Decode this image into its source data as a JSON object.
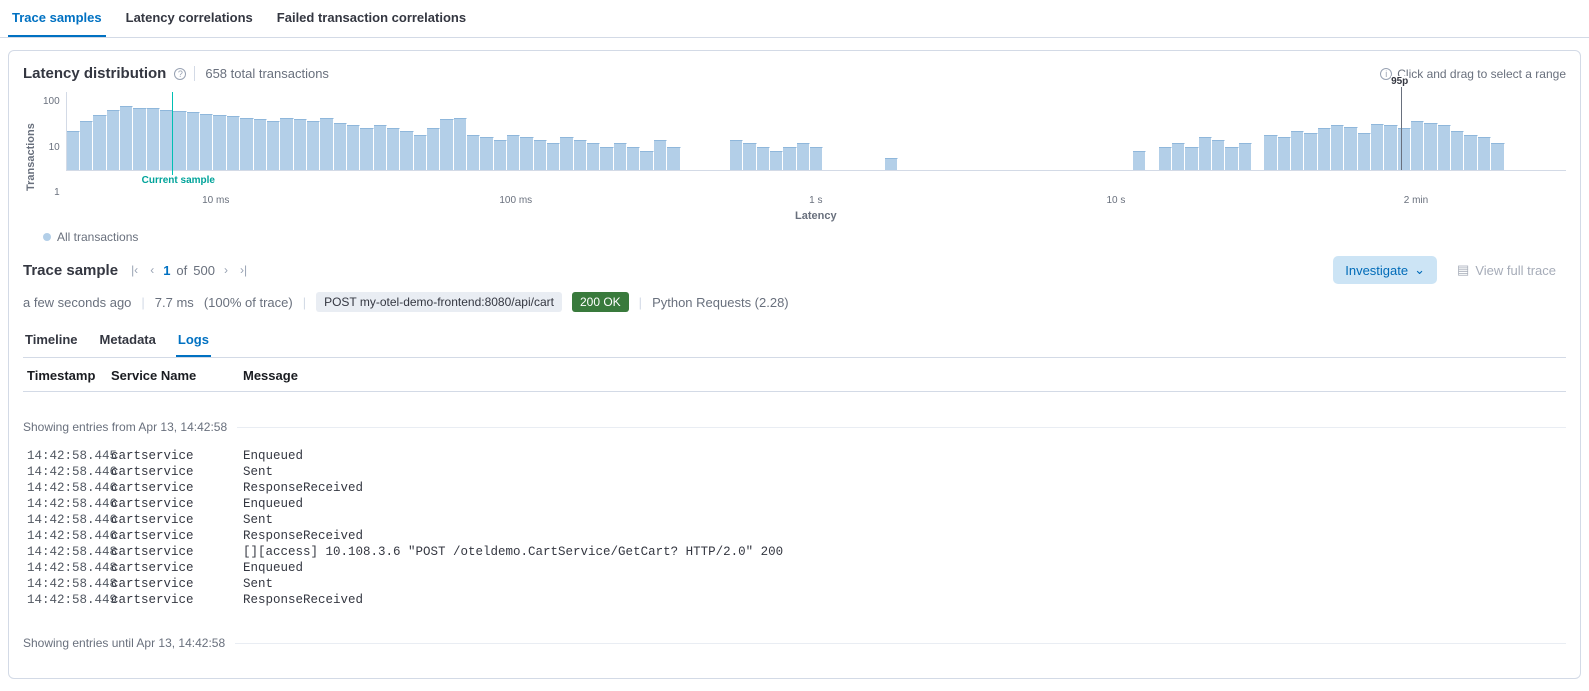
{
  "mainTabs": [
    "Trace samples",
    "Latency correlations",
    "Failed transaction correlations"
  ],
  "mainActive": 0,
  "dist": {
    "title": "Latency distribution",
    "sub": "658 total transactions",
    "hint": "Click and drag to select a range",
    "ylabel": "Transactions",
    "xlabel": "Latency",
    "yticks": [
      "100",
      "10",
      "1"
    ],
    "xticks": [
      "10 ms",
      "100 ms",
      "1 s",
      "10 s",
      "2 min"
    ],
    "p95Label": "95p",
    "currentLabel": "Current sample",
    "legend": "All transactions"
  },
  "chart_data": {
    "type": "bar",
    "title": "Latency distribution",
    "xlabel": "Latency",
    "ylabel": "Transactions",
    "yscale": "log",
    "ylim": [
      1,
      100
    ],
    "xticks": [
      "10 ms",
      "100 ms",
      "1 s",
      "10 s",
      "2 min"
    ],
    "current_sample_position_pct": 7,
    "p95_position_pct": 89,
    "series": [
      {
        "name": "All transactions",
        "values": [
          10,
          18,
          25,
          35,
          45,
          40,
          38,
          35,
          32,
          30,
          28,
          26,
          24,
          22,
          20,
          18,
          22,
          20,
          18,
          22,
          16,
          14,
          12,
          14,
          12,
          10,
          8,
          12,
          20,
          22,
          8,
          7,
          6,
          8,
          7,
          6,
          5,
          7,
          6,
          5,
          4,
          5,
          4,
          3,
          6,
          4,
          0,
          0,
          0,
          0,
          6,
          5,
          4,
          3,
          4,
          5,
          4,
          0,
          0,
          0,
          0,
          0,
          2,
          0,
          0,
          0,
          0,
          0,
          0,
          0,
          0,
          0,
          0,
          0,
          0,
          0,
          0,
          0,
          0,
          0,
          0,
          0,
          3,
          0,
          4,
          5,
          4,
          7,
          6,
          4,
          5,
          0,
          8,
          7,
          10,
          9,
          12,
          14,
          13,
          9,
          15,
          14,
          12,
          18,
          16,
          14,
          10,
          8,
          7,
          5,
          0,
          0,
          0,
          0,
          0
        ]
      }
    ]
  },
  "trace": {
    "title": "Trace sample",
    "page": "1",
    "of": "of",
    "total": "500",
    "investigate": "Investigate",
    "viewFull": "View full trace",
    "ago": "a few seconds ago",
    "latency": "7.7 ms",
    "pct": "(100% of trace)",
    "reqPill": "POST my-otel-demo-frontend:8080/api/cart",
    "statusPill": "200 OK",
    "ua": "Python Requests (2.28)"
  },
  "subTabs": [
    "Timeline",
    "Metadata",
    "Logs"
  ],
  "subActive": 2,
  "logHead": {
    "ts": "Timestamp",
    "svc": "Service Name",
    "msg": "Message"
  },
  "logDiv1": "Showing entries from Apr 13, 14:42:58",
  "logDiv2": "Showing entries until Apr 13, 14:42:58",
  "logs": [
    {
      "ts": "14:42:58.445",
      "svc": "cartservice",
      "msg": "Enqueued"
    },
    {
      "ts": "14:42:58.446",
      "svc": "cartservice",
      "msg": "Sent"
    },
    {
      "ts": "14:42:58.446",
      "svc": "cartservice",
      "msg": "ResponseReceived"
    },
    {
      "ts": "14:42:58.446",
      "svc": "cartservice",
      "msg": "Enqueued"
    },
    {
      "ts": "14:42:58.446",
      "svc": "cartservice",
      "msg": "Sent"
    },
    {
      "ts": "14:42:58.446",
      "svc": "cartservice",
      "msg": "ResponseReceived"
    },
    {
      "ts": "14:42:58.448",
      "svc": "cartservice",
      "msg": "[][access] 10.108.3.6  \"POST /oteldemo.CartService/GetCart? HTTP/2.0\" 200"
    },
    {
      "ts": "14:42:58.448",
      "svc": "cartservice",
      "msg": "Enqueued"
    },
    {
      "ts": "14:42:58.448",
      "svc": "cartservice",
      "msg": "Sent"
    },
    {
      "ts": "14:42:58.449",
      "svc": "cartservice",
      "msg": "ResponseReceived"
    }
  ]
}
